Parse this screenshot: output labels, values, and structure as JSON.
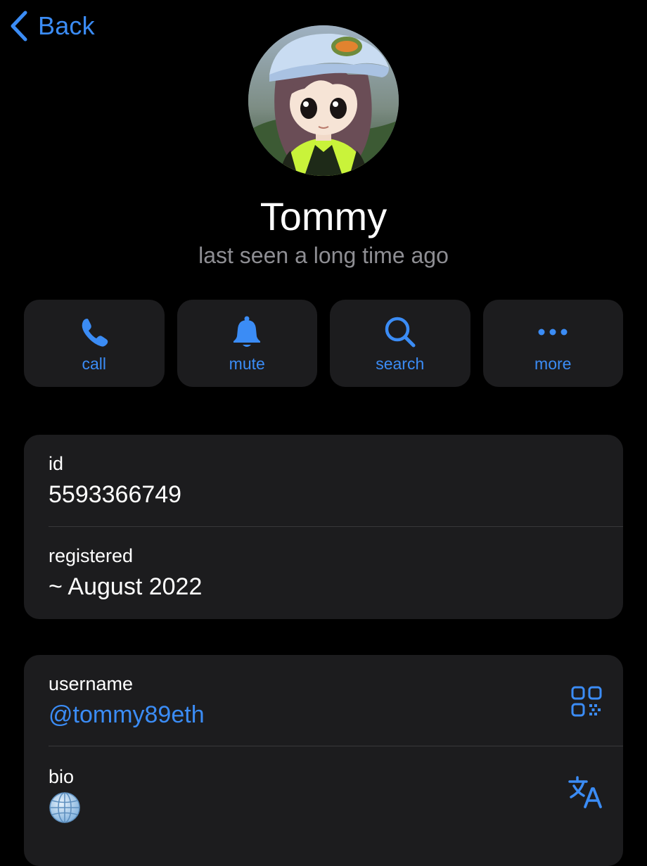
{
  "nav": {
    "back_label": "Back"
  },
  "profile": {
    "name": "Tommy",
    "status": "last seen a long time ago"
  },
  "actions": [
    {
      "label": "call",
      "icon": "phone-icon"
    },
    {
      "label": "mute",
      "icon": "bell-icon"
    },
    {
      "label": "search",
      "icon": "search-icon"
    },
    {
      "label": "more",
      "icon": "more-icon"
    }
  ],
  "info": {
    "id_label": "id",
    "id_value": "5593366749",
    "registered_label": "registered",
    "registered_value": "~ August 2022",
    "username_label": "username",
    "username_value": "@tommy89eth",
    "bio_label": "bio",
    "bio_icon": "globe-icon"
  },
  "colors": {
    "accent": "#3b8cf5",
    "background": "#000000",
    "card": "#1c1c1e",
    "secondary_text": "#8e8e93",
    "separator": "#38383a"
  }
}
